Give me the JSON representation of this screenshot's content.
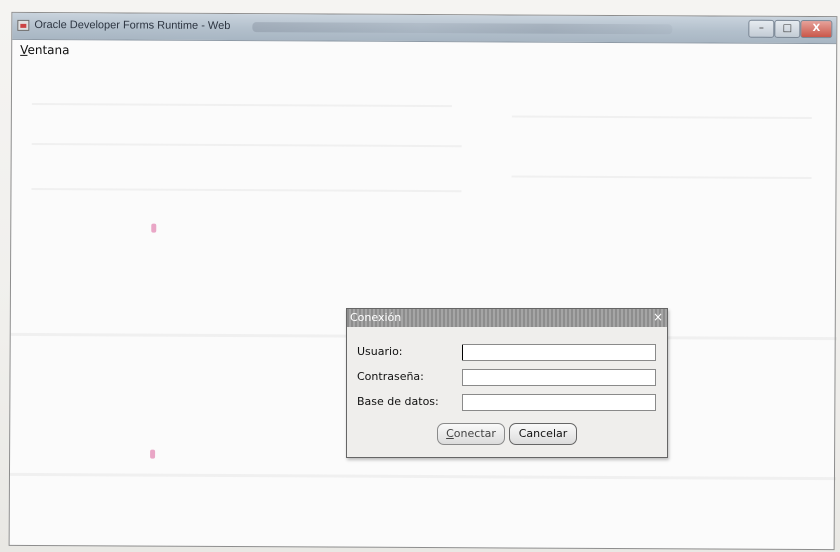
{
  "window": {
    "title": "Oracle Developer Forms Runtime - Web",
    "controls": {
      "minimize": "–",
      "maximize": "□",
      "close": "X"
    }
  },
  "menubar": {
    "items": [
      {
        "label_mnemonic": "V",
        "label_rest": "entana"
      }
    ]
  },
  "dialog": {
    "title": "Conexión",
    "close": "×",
    "fields": [
      {
        "label": "Usuario:",
        "value": ""
      },
      {
        "label": "Contraseña:",
        "value": ""
      },
      {
        "label": "Base de datos:",
        "value": ""
      }
    ],
    "buttons": {
      "connect_mnemonic": "C",
      "connect_rest": "onectar",
      "cancel": "Cancelar"
    }
  },
  "colors": {
    "titlebar": "#b3c0cc",
    "dialog_title": "#9a9a9a",
    "dialog_bg": "#efeeec"
  }
}
